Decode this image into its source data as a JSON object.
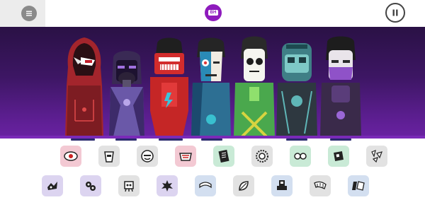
{
  "topbar": {
    "menu_icon": "menu-icon",
    "center_badge_text": "BH",
    "center_badge_color": "#8e1bbd",
    "pause_icon": "pause-icon"
  },
  "stage": {
    "background_top": "#2a1145",
    "background_bottom": "#6a22a3",
    "characters": [
      {
        "name": "red-hooded-character",
        "active": true
      },
      {
        "name": "gasmask-character",
        "active": true
      },
      {
        "name": "red-robot-character",
        "active": true
      },
      {
        "name": "blue-split-face-character",
        "active": true
      },
      {
        "name": "green-mask-character",
        "active": false
      },
      {
        "name": "teal-helmet-character",
        "active": true
      },
      {
        "name": "purple-masked-character",
        "active": true
      }
    ]
  },
  "icons": {
    "row1": [
      {
        "name": "pink-eye-icon",
        "bg": "#f3c9d3"
      },
      {
        "name": "cup-icon",
        "bg": "#e2e2e2"
      },
      {
        "name": "face-icon",
        "bg": "#e2e2e2"
      },
      {
        "name": "mask-pink-icon",
        "bg": "#f3c9d3"
      },
      {
        "name": "notebook-icon",
        "bg": "#c9ead6"
      },
      {
        "name": "sawblade-icon",
        "bg": "#e2e2e2"
      },
      {
        "name": "goggles-icon",
        "bg": "#c9ead6"
      },
      {
        "name": "green-square-icon",
        "bg": "#c9ead6"
      },
      {
        "name": "shards-icon",
        "bg": "#e2e2e2"
      }
    ],
    "row2": [
      {
        "name": "claw-icon",
        "bg": "#dcd4f0"
      },
      {
        "name": "gear-cluster-icon",
        "bg": "#dcd4f0"
      },
      {
        "name": "robot-head-icon",
        "bg": "#e2e2e2"
      },
      {
        "name": "splat-icon",
        "bg": "#dcd4f0"
      },
      {
        "name": "bridge-icon",
        "bg": "#d3dff0"
      },
      {
        "name": "leaf-icon",
        "bg": "#e2e2e2"
      },
      {
        "name": "stamp-icon",
        "bg": "#d3dff0"
      },
      {
        "name": "hose-icon",
        "bg": "#e2e2e2"
      },
      {
        "name": "waves-icon",
        "bg": "#d3dff0"
      }
    ]
  }
}
